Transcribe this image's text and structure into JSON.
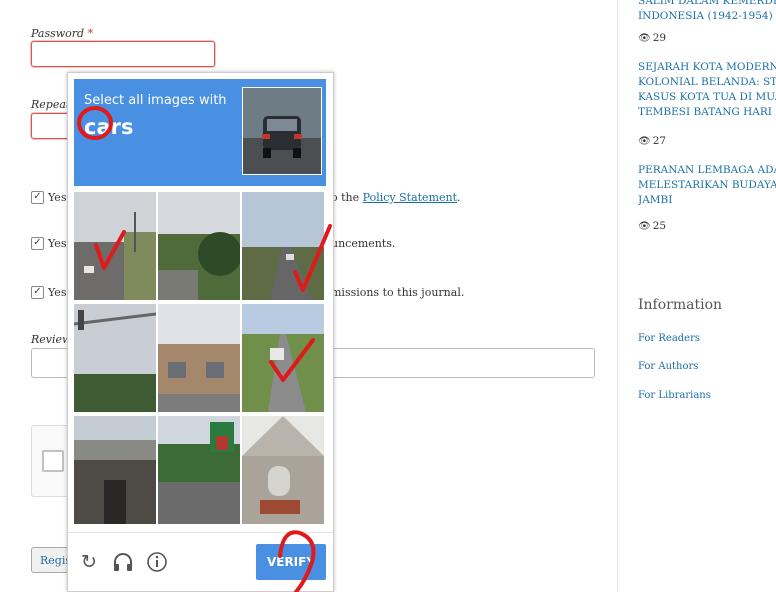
{
  "form": {
    "password_label": "Password",
    "required_mark": "*",
    "repeat_label": "Repeat p",
    "option1_prefix": "Yes,",
    "option1_suffix": "o the",
    "option1_link": "Policy Statement",
    "option1_end": ".",
    "option2_prefix": "Yes,",
    "option2_suffix": "uncements.",
    "option3_prefix": "Yes,",
    "option3_suffix": "missions to this journal.",
    "reviewing_label": "Reviewi",
    "register_label": "Regis"
  },
  "sidebar": {
    "articles": [
      {
        "lines": [
          "SALIM DALAM KEMERDEKA",
          "INDONESIA (1942-1954)"
        ],
        "views": "29"
      },
      {
        "lines": [
          "SEJARAH KOTA MODERN MA",
          "KOLONIAL BELANDA: STUDI",
          "KASUS KOTA TUA DI MUARO",
          "TEMBESI BATANG HARI"
        ],
        "views": "27"
      },
      {
        "lines": [
          "PERANAN LEMBAGA ADAT D",
          "MELESTARIKAN BUDAYA ME",
          "JAMBI"
        ],
        "views": "25"
      }
    ],
    "information_title": "Information",
    "links": [
      "For Readers",
      "For Authors",
      "For Librarians"
    ]
  },
  "captcha": {
    "instruction": "Select all images with",
    "target": "cars",
    "verify_label": "VERIFY",
    "icons": [
      "refresh-icon",
      "headphones-icon",
      "info-icon"
    ],
    "accent_color": "#4a90e2"
  }
}
